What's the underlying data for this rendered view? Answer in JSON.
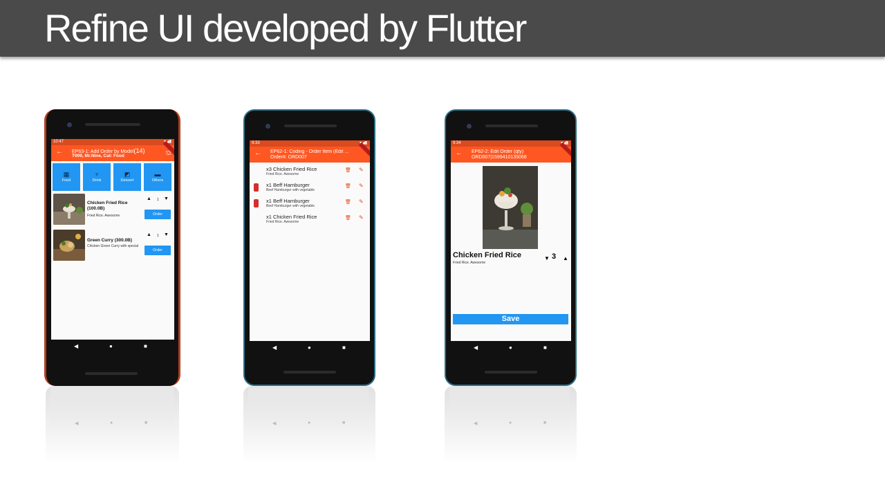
{
  "slide": {
    "title": "Refine UI developed by Flutter"
  },
  "phone1": {
    "status_time": "10:47",
    "appbar_title": "EP63-1: Add Order by Model",
    "appbar_count": "(14)",
    "appbar_subtitle": "T009, Mr.Nine, Cat: Food",
    "categories": [
      {
        "label": "Food",
        "icon": "grid-icon"
      },
      {
        "label": "Drink",
        "icon": "drink-icon"
      },
      {
        "label": "Dessert",
        "icon": "dessert-icon"
      },
      {
        "label": "Others",
        "icon": "others-icon"
      }
    ],
    "items": [
      {
        "name": "Chicken Fried Rice (100.0B)",
        "desc": "Fried Rice. Awesome",
        "qty": "1",
        "order_label": "Order"
      },
      {
        "name": "Green Curry (300.0B)",
        "desc": "Chicken Green Curry with special",
        "qty": "1",
        "order_label": "Order"
      }
    ]
  },
  "phone2": {
    "status_time": "9:33",
    "appbar_title": "EP62-1: Coding - Order Item (Edit ...",
    "appbar_subtitle": "Order#: ORD007",
    "items": [
      {
        "name": "x3 Chicken Fried Rice",
        "desc": "Fried Rice. Awesome",
        "has_image": false
      },
      {
        "name": "x1 Beff Hamburger",
        "desc": "Beef Hamburger with vegetable",
        "has_image": true
      },
      {
        "name": "x1 Beff Hamburger",
        "desc": "Beef Hamburger with vegetable",
        "has_image": true
      },
      {
        "name": "x1 Chicken Fried Rice",
        "desc": "Fried Rice. Awesome",
        "has_image": false
      }
    ]
  },
  "phone3": {
    "status_time": "9:34",
    "appbar_title": "EP62-2: Edit Order (qty)",
    "appbar_subtitle": "ORD007|1599410135068",
    "item_name": "Chicken Fried Rice",
    "item_desc": "Fried Rice. Awesome",
    "qty": "3",
    "save_label": "Save"
  },
  "colors": {
    "title_bar": "#4a4a4a",
    "appbar": "#ff5722",
    "primary_button": "#2196f3",
    "action_icon": "#e64a19"
  }
}
